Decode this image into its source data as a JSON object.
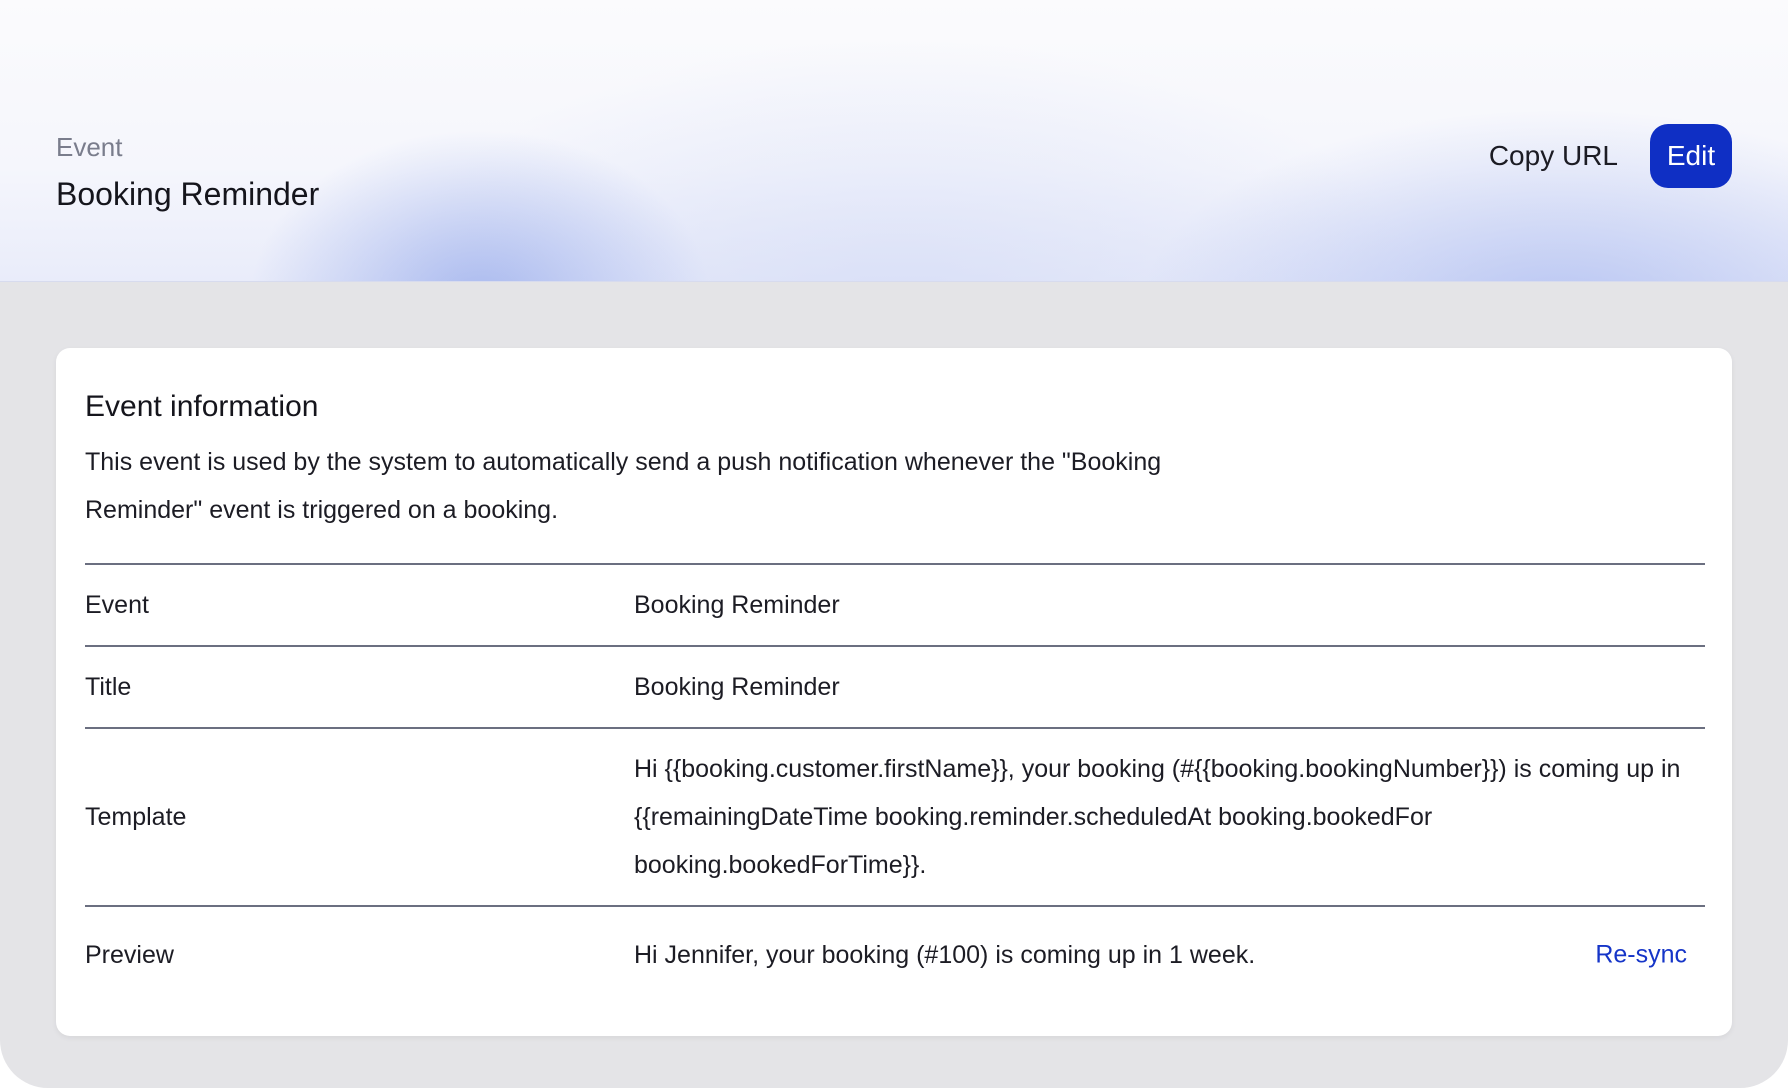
{
  "header": {
    "eyebrow": "Event",
    "title": "Booking Reminder",
    "copy_url_label": "Copy URL",
    "edit_label": "Edit"
  },
  "card": {
    "title": "Event information",
    "description": "This event is used by the system to automatically send a push notification whenever the \"Booking Reminder\" event is triggered on a booking.",
    "rows": [
      {
        "label": "Event",
        "value": "Booking Reminder"
      },
      {
        "label": "Title",
        "value": "Booking Reminder"
      },
      {
        "label": "Template",
        "value": "Hi {{booking.customer.firstName}}, your booking (#{{booking.bookingNumber}}) is coming up in {{remainingDateTime booking.reminder.scheduledAt booking.bookedFor booking.bookedForTime}}."
      },
      {
        "label": "Preview",
        "value": "Hi Jennifer, your booking (#100) is coming up in 1 week.",
        "action_label": "Re-sync"
      }
    ]
  },
  "colors": {
    "accent": "#0f2fc4",
    "link": "#1535c8",
    "background": "#e4e4e7"
  }
}
